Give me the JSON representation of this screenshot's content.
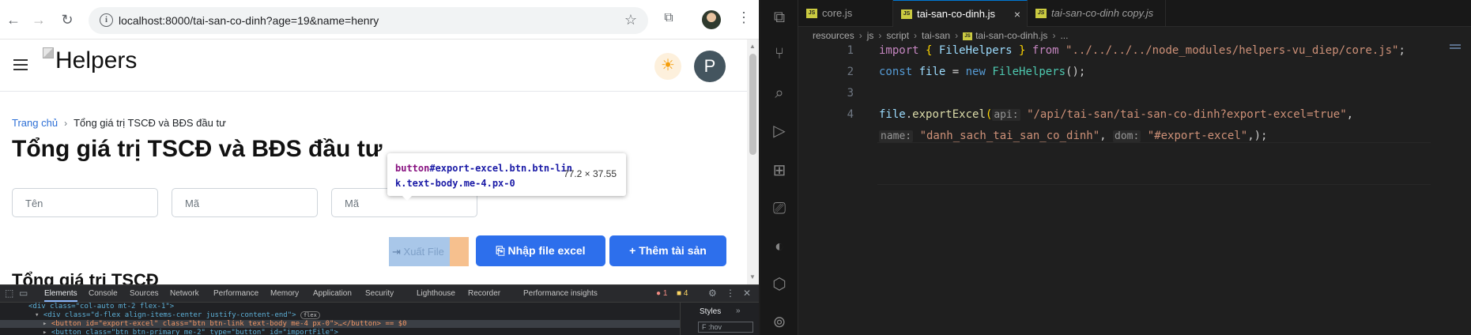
{
  "browser": {
    "url": "localhost:8000/tai-san-co-dinh?age=19&name=henry",
    "logo_text": "Helpers",
    "avatar_letter": "P",
    "breadcrumb": {
      "home": "Trang chủ",
      "current": "Tổng giá trị TSCĐ và BĐS đầu tư"
    },
    "page_title": "Tổng giá trị TSCĐ và BĐS đầu tư",
    "filters": [
      {
        "placeholder": "Tên"
      },
      {
        "placeholder": "Mã"
      },
      {
        "placeholder": "Mã"
      }
    ],
    "tooltip": {
      "tag": "button",
      "selector_line1": "#export-excel.btn.btn-lin",
      "selector_line2": "k.text-body.me-4.px-0",
      "dims": "77.2 × 37.55"
    },
    "buttons": {
      "export_label": "Xuất File",
      "import_label": "Nhập file excel",
      "add_label": "Thêm tài sản"
    },
    "section_title": "Tổng giá trị TSCĐ",
    "devtools": {
      "tabs": [
        "Elements",
        "Console",
        "Sources",
        "Network",
        "Performance",
        "Memory",
        "Application",
        "Security",
        "Lighthouse",
        "Recorder",
        "Performance insights"
      ],
      "active_tab": "Elements",
      "error_count": "1",
      "warn_count": "4",
      "code_lines": [
        "<div class=\"col-auto mt-2 flex-1\">",
        "<div class=\"d-flex align-items-center justify-content-end\">",
        "<button id=\"export-excel\" class=\"btn btn-link text-body me-4 px-0\">…</button> == $0",
        "<button class=\"btn btn-primary me-2\" type=\"button\" id=\"importFile\">"
      ],
      "flex_badge": "flex",
      "styles_tab": "Styles",
      "filter_placeholder": "F :hov"
    }
  },
  "vscode": {
    "tabs": [
      {
        "label": "core.js"
      },
      {
        "label": "tai-san-co-dinh.js",
        "active": true
      },
      {
        "label": "tai-san-co-dinh copy.js"
      }
    ],
    "breadcrumb": [
      "resources",
      "js",
      "script",
      "tai-san",
      "tai-san-co-dinh.js",
      "..."
    ],
    "code": {
      "line_numbers": [
        "1",
        "2",
        "3",
        "4"
      ],
      "l1": {
        "kw": "import",
        "open": "{ ",
        "name": "FileHelpers",
        "close": " }",
        "from": "from",
        "path": "\"../../../../node_modules/helpers-vu_diep/core.js\"",
        "end": ";"
      },
      "l2": {
        "kw": "const",
        "var": "file",
        "eq": " = ",
        "new": "new",
        "cls": "FileHelpers",
        "end": "();"
      },
      "l4a": {
        "obj": "file",
        "method": "exportExcel",
        "open": "(",
        "hint": "api:",
        "val": "\"/api/tai-san/tai-san-co-dinh?export-excel=true\"",
        "end": ","
      },
      "l4b": {
        "hint1": "name:",
        "val1": "\"danh_sach_tai_san_co_dinh\"",
        "sep": ", ",
        "hint2": "dom:",
        "val2": "\"#export-excel\"",
        "end": ",);"
      }
    }
  }
}
